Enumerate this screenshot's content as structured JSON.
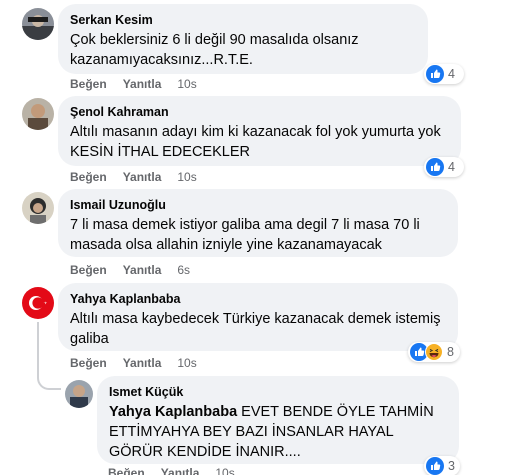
{
  "colors": {
    "bubble": "#f0f2f5",
    "secondary_text": "#65676b",
    "like_blue": "#1877f2",
    "haha_yellow": "#f7b125"
  },
  "comments": [
    {
      "author": "Serkan Kesim",
      "text": "Çok beklersiniz 6 li değil 90 masalıda olsanız kazanamıyacaksınız...R.T.E.",
      "like_label": "Beğen",
      "reply_label": "Yanıtla",
      "time": "10s",
      "reaction_count": "4",
      "reaction_icons": [
        "like-icon"
      ]
    },
    {
      "author": "Şenol Kahraman",
      "text": "Altılı masanın adayı kim ki kazanacak fol yok yumurta yok KESİN İTHAL EDECEKLER",
      "like_label": "Beğen",
      "reply_label": "Yanıtla",
      "time": "10s",
      "reaction_count": "4",
      "reaction_icons": [
        "like-icon"
      ]
    },
    {
      "author": "Ismail Uzunoğlu",
      "text": "7 li masa demek istiyor galiba ama degil 7 li masa 70 li masada olsa allahin izniyle yine kazanamayacak",
      "like_label": "Beğen",
      "reply_label": "Yanıtla",
      "time": "6s"
    },
    {
      "author": "Yahya Kaplanbaba",
      "text": "Altılı masa kaybedecek Türkiye kazanacak demek istemiş galiba",
      "like_label": "Beğen",
      "reply_label": "Yanıtla",
      "time": "10s",
      "reaction_count": "8",
      "reaction_icons": [
        "like-icon",
        "haha-icon"
      ]
    }
  ],
  "reply": {
    "author": "Ismet Küçük",
    "mention": "Yahya Kaplanbaba",
    "text": " EVET BENDE ÖYLE TAHMİN ETTİMYAHYA BEY BAZI İNSANLAR HAYAL GÖRÜR KENDİDE İNANIR....",
    "like_label": "Beğen",
    "reply_label": "Yanıtla",
    "time": "10s",
    "reaction_count": "3",
    "reaction_icons": [
      "like-icon"
    ]
  }
}
